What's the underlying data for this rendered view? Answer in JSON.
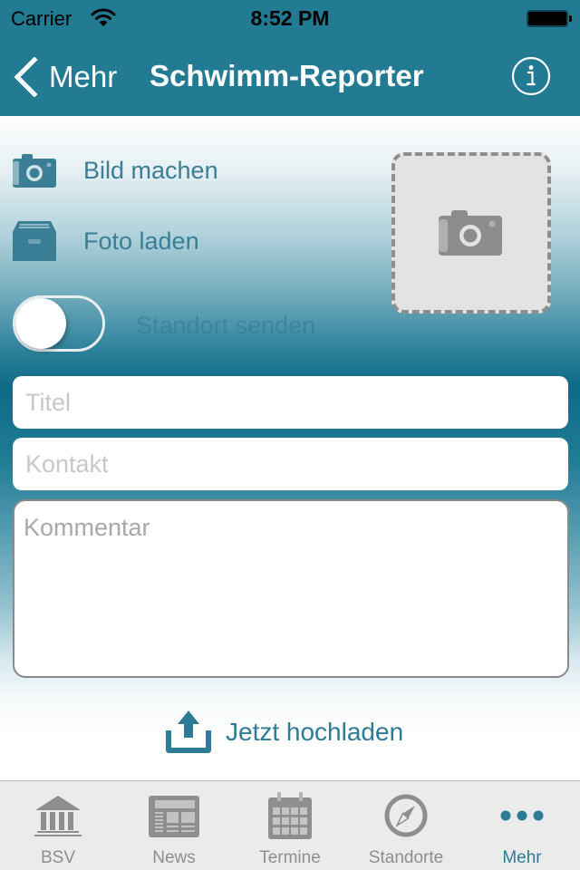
{
  "status_bar": {
    "carrier": "Carrier",
    "time": "8:52 PM",
    "wifi_icon": "wifi-icon",
    "battery_icon": "battery-full-icon"
  },
  "nav": {
    "back_label": "Mehr",
    "back_icon": "chevron-left-icon",
    "title": "Schwimm-Reporter",
    "info_icon": "info-circle-icon"
  },
  "actions": {
    "take_photo": {
      "label": "Bild machen",
      "icon": "camera-icon"
    },
    "load_photo": {
      "label": "Foto laden",
      "icon": "archive-box-icon"
    }
  },
  "image_placeholder": {
    "icon": "camera-placeholder-icon"
  },
  "location_toggle": {
    "label": "Standort senden",
    "on": false
  },
  "form": {
    "title_placeholder": "Titel",
    "title_value": "",
    "contact_placeholder": "Kontakt",
    "contact_value": "",
    "comment_placeholder": "Kommentar",
    "comment_value": ""
  },
  "upload": {
    "label": "Jetzt hochladen",
    "icon": "upload-icon"
  },
  "tabbar": {
    "items": [
      {
        "label": "BSV",
        "icon": "bank-building-icon",
        "active": false
      },
      {
        "label": "News",
        "icon": "newspaper-icon",
        "active": false
      },
      {
        "label": "Termine",
        "icon": "calendar-icon",
        "active": false
      },
      {
        "label": "Standorte",
        "icon": "compass-icon",
        "active": false
      },
      {
        "label": "Mehr",
        "icon": "more-dots-icon",
        "active": true
      }
    ]
  },
  "colors": {
    "brand": "#227b93",
    "accent_text": "#2d7b94",
    "tab_inactive": "#8e8e8e",
    "tab_active": "#2e7b94"
  }
}
